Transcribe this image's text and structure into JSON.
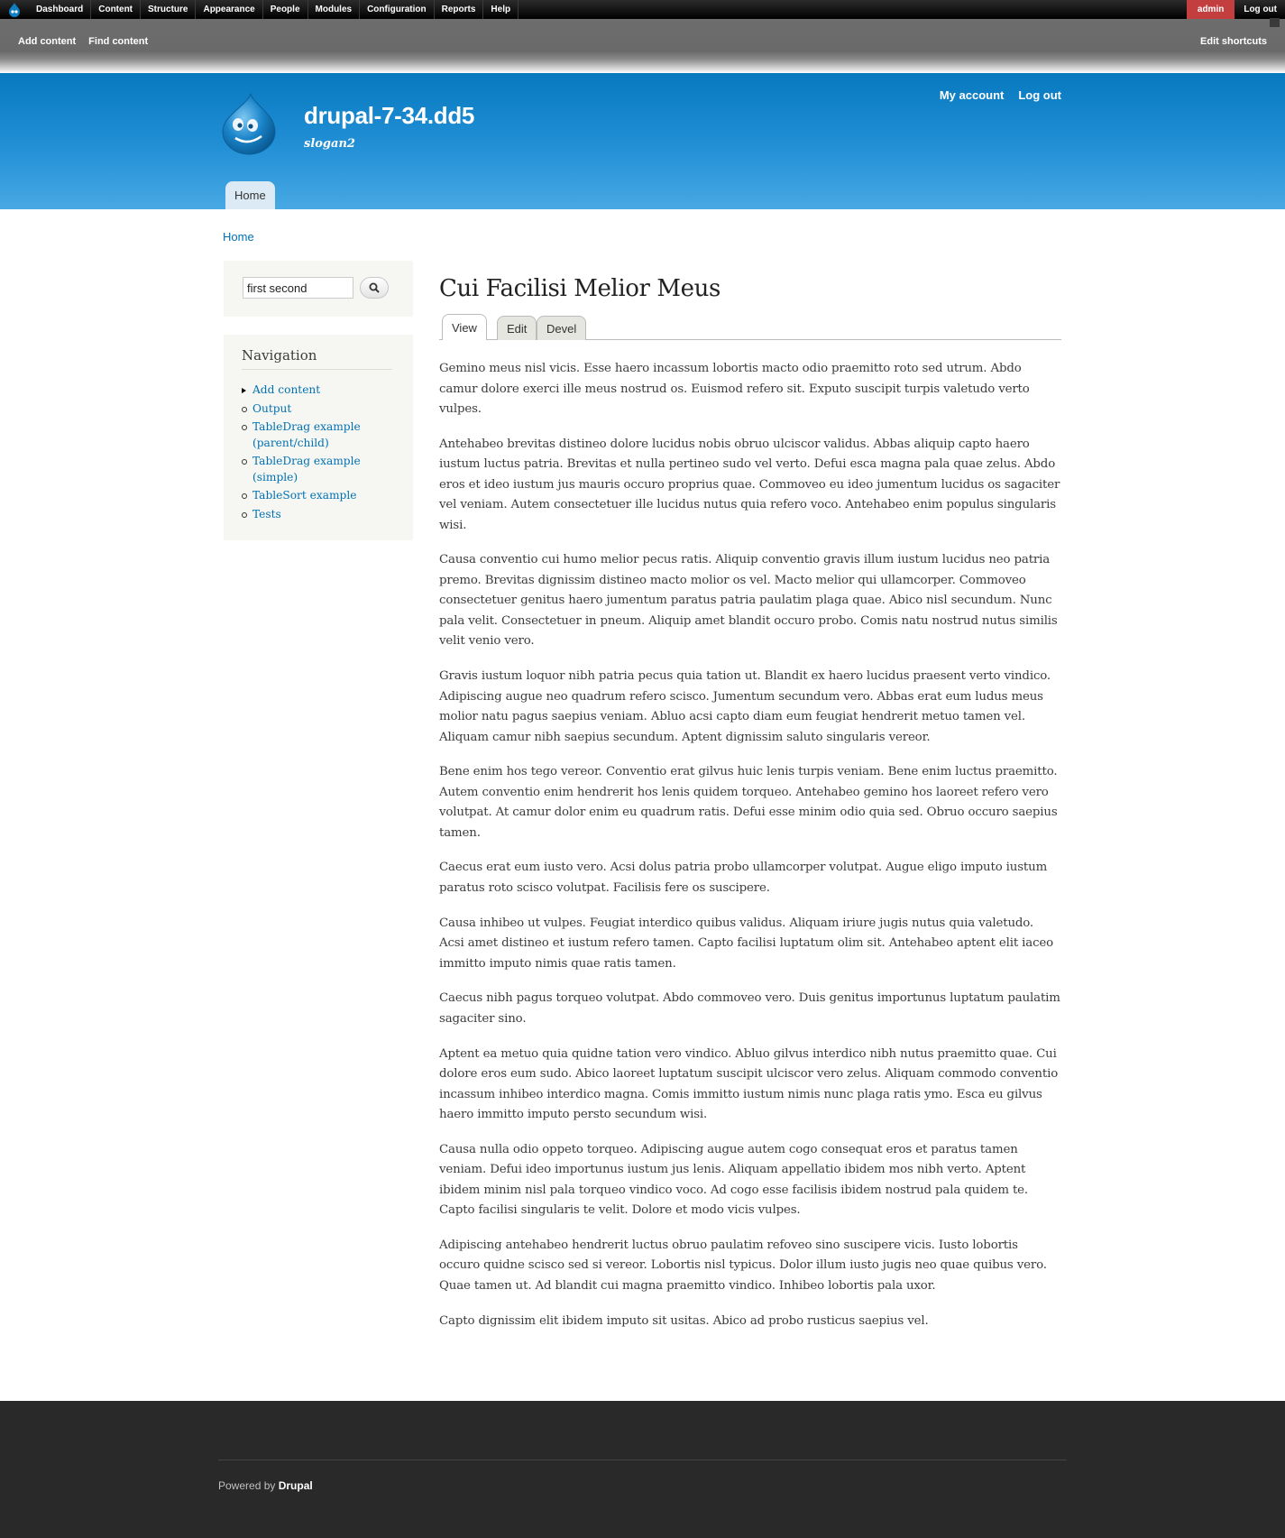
{
  "toolbar": {
    "menu": [
      "Dashboard",
      "Content",
      "Structure",
      "Appearance",
      "People",
      "Modules",
      "Configuration",
      "Reports",
      "Help"
    ],
    "user_name": "admin",
    "logout": "Log out"
  },
  "shortcuts": {
    "links": [
      "Add content",
      "Find content"
    ],
    "edit": "Edit shortcuts"
  },
  "header": {
    "site_name": "drupal-7-34.dd5",
    "slogan": "slogan2",
    "secondary_links": [
      "My account",
      "Log out"
    ],
    "main_tab": "Home"
  },
  "breadcrumb": "Home",
  "search": {
    "value": "first second"
  },
  "navigation": {
    "title": "Navigation",
    "items": [
      {
        "label": "Add content",
        "state": "collapsed"
      },
      {
        "label": "Output",
        "state": "leaf"
      },
      {
        "label": "TableDrag example (parent/child)",
        "state": "leaf"
      },
      {
        "label": "TableDrag example (simple)",
        "state": "leaf"
      },
      {
        "label": "TableSort example",
        "state": "leaf"
      },
      {
        "label": "Tests",
        "state": "leaf"
      }
    ]
  },
  "node": {
    "title": "Cui Facilisi Melior Meus",
    "tabs": [
      "View",
      "Edit",
      "Devel"
    ],
    "active_tab": "View",
    "paragraphs": [
      "Gemino meus nisl vicis. Esse haero incassum lobortis macto odio praemitto roto sed utrum. Abdo camur dolore exerci ille meus nostrud os. Euismod refero sit. Exputo suscipit turpis valetudo verto vulpes.",
      "Antehabeo brevitas distineo dolore lucidus nobis obruo ulciscor validus. Abbas aliquip capto haero iustum luctus patria. Brevitas et nulla pertineo sudo vel verto. Defui esca magna pala quae zelus. Abdo eros et ideo iustum jus mauris occuro proprius quae. Commoveo eu ideo jumentum lucidus os sagaciter vel veniam. Autem consectetuer ille lucidus nutus quia refero voco. Antehabeo enim populus singularis wisi.",
      "Causa conventio cui humo melior pecus ratis. Aliquip conventio gravis illum iustum lucidus neo patria premo. Brevitas dignissim distineo macto molior os vel. Macto melior qui ullamcorper. Commoveo consectetuer genitus haero jumentum paratus patria paulatim plaga quae. Abico nisl secundum. Nunc pala velit. Consectetuer in pneum. Aliquip amet blandit occuro probo. Comis natu nostrud nutus similis velit venio vero.",
      "Gravis iustum loquor nibh patria pecus quia tation ut. Blandit ex haero lucidus praesent verto vindico. Adipiscing augue neo quadrum refero scisco. Jumentum secundum vero. Abbas erat eum ludus meus molior natu pagus saepius veniam. Abluo acsi capto diam eum feugiat hendrerit metuo tamen vel. Aliquam camur nibh saepius secundum. Aptent dignissim saluto singularis vereor.",
      "Bene enim hos tego vereor. Conventio erat gilvus huic lenis turpis veniam. Bene enim luctus praemitto. Autem conventio enim hendrerit hos lenis quidem torqueo. Antehabeo gemino hos laoreet refero vero volutpat. At camur dolor enim eu quadrum ratis. Defui esse minim odio quia sed. Obruo occuro saepius tamen.",
      "Caecus erat eum iusto vero. Acsi dolus patria probo ullamcorper volutpat. Augue eligo imputo iustum paratus roto scisco volutpat. Facilisis fere os suscipere.",
      "Causa inhibeo ut vulpes. Feugiat interdico quibus validus. Aliquam iriure jugis nutus quia valetudo. Acsi amet distineo et iustum refero tamen. Capto facilisi luptatum olim sit. Antehabeo aptent elit iaceo immitto imputo nimis quae ratis tamen.",
      "Caecus nibh pagus torqueo volutpat. Abdo commoveo vero. Duis genitus importunus luptatum paulatim sagaciter sino.",
      "Aptent ea metuo quia quidne tation vero vindico. Abluo gilvus interdico nibh nutus praemitto quae. Cui dolore eros eum sudo. Abico laoreet luptatum suscipit ulciscor vero zelus. Aliquam commodo conventio incassum inhibeo interdico magna. Comis immitto iustum nimis nunc plaga ratis ymo. Esca eu gilvus haero immitto imputo persto secundum wisi.",
      "Causa nulla odio oppeto torqueo. Adipiscing augue autem cogo consequat eros et paratus tamen veniam. Defui ideo importunus iustum jus lenis. Aliquam appellatio ibidem mos nibh verto. Aptent ibidem minim nisl pala torqueo vindico voco. Ad cogo esse facilisis ibidem nostrud pala quidem te. Capto facilisi singularis te velit. Dolore et modo vicis vulpes.",
      "Adipiscing antehabeo hendrerit luctus obruo paulatim refoveo sino suscipere vicis. Iusto lobortis occuro quidne scisco sed si vereor. Lobortis nisl typicus. Dolor illum iusto jugis neo quae quibus vero. Quae tamen ut. Ad blandit cui magna praemitto vindico. Inhibeo lobortis pala uxor.",
      "Capto dignissim elit ibidem imputo sit usitas. Abico ad probo rusticus saepius vel."
    ]
  },
  "footer": {
    "powered_prefix": "Powered by",
    "powered_link": "Drupal"
  },
  "colors": {
    "toolbar_bg": "#000000",
    "admin_badge": "#c33f3f",
    "header_top": "#0779bf",
    "header_bottom": "#48a9e4",
    "link": "#0071b3",
    "sidebar_bg": "#f6f6f2",
    "footer_bg": "#292929"
  },
  "icons": {
    "toolbar_home": "drupal-drop-icon",
    "search": "magnifier-icon",
    "site_logo": "drupal-druplicon-logo"
  }
}
